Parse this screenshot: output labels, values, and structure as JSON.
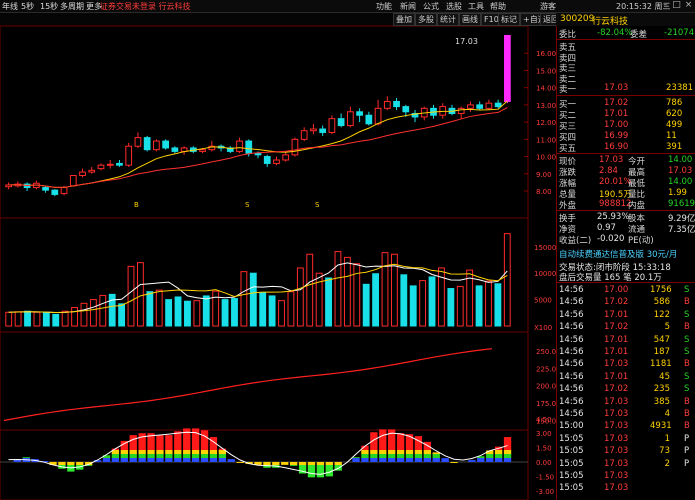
{
  "topbar": {
    "notice": "证券交易未登录  行云科技",
    "menus": [
      "功能",
      "新闻",
      "公式",
      "选股",
      "工具",
      "帮助"
    ],
    "app_name": "游客",
    "clock": "20:15:32 周三",
    "icon_minimize": "minimize-icon",
    "icon_maximize": "maximize-icon",
    "icon_close": "close-icon"
  },
  "periods": [
    "年线",
    "5秒",
    "15秒",
    "多周期",
    "更多"
  ],
  "tools": [
    "叠加",
    "多股",
    "统计",
    "画线",
    "F10",
    "标记",
    "+自选",
    "返回"
  ],
  "stock": {
    "code": "300209",
    "name": "行云科技"
  },
  "chart": {
    "high_label": "17.03",
    "price_axis": [
      "16.00",
      "15.00",
      "14.00",
      "13.00",
      "12.00",
      "11.00",
      "10.00",
      "9.00",
      "8.00"
    ],
    "vol_axis": [
      "15000",
      "10000",
      "5000",
      "X100"
    ],
    "ind_axis": [
      "250.0",
      "225.0",
      "200.0",
      "175.0",
      "150.0"
    ],
    "macd_axis": [
      "4.50",
      "3.00",
      "1.50",
      "0.00",
      "-1.50",
      "-3.00"
    ],
    "markers": [
      "B",
      "S",
      "S",
      "S"
    ],
    "colors": {
      "up": "#ff2a2a",
      "down": "#19e0e8",
      "limit": "#ff2aff",
      "ma": "#ffd200",
      "ma2": "#ff3030"
    },
    "candles": [
      {
        "o": 8.25,
        "c": 8.35,
        "h": 8.5,
        "l": 8.1
      },
      {
        "o": 8.3,
        "c": 8.4,
        "h": 8.55,
        "l": 8.2
      },
      {
        "o": 8.4,
        "c": 8.2,
        "h": 8.5,
        "l": 8.0
      },
      {
        "o": 8.2,
        "c": 8.45,
        "h": 8.6,
        "l": 8.1
      },
      {
        "o": 8.2,
        "c": 8.05,
        "h": 8.3,
        "l": 7.9
      },
      {
        "o": 8.05,
        "c": 7.8,
        "h": 8.1,
        "l": 7.7
      },
      {
        "o": 7.85,
        "c": 8.2,
        "h": 8.3,
        "l": 7.75
      },
      {
        "o": 8.3,
        "c": 8.9,
        "h": 8.9,
        "l": 8.25
      },
      {
        "o": 8.9,
        "c": 9.1,
        "h": 9.3,
        "l": 8.8
      },
      {
        "o": 9.1,
        "c": 9.2,
        "h": 9.4,
        "l": 9.0
      },
      {
        "o": 9.3,
        "c": 9.5,
        "h": 9.6,
        "l": 9.2
      },
      {
        "o": 9.5,
        "c": 9.55,
        "h": 9.8,
        "l": 9.3
      },
      {
        "o": 9.6,
        "c": 9.5,
        "h": 9.8,
        "l": 9.4
      },
      {
        "o": 9.5,
        "c": 10.6,
        "h": 10.8,
        "l": 9.4
      },
      {
        "o": 10.6,
        "c": 11.1,
        "h": 11.4,
        "l": 10.5
      },
      {
        "o": 11.1,
        "c": 10.4,
        "h": 11.2,
        "l": 10.3
      },
      {
        "o": 10.4,
        "c": 10.9,
        "h": 11.0,
        "l": 10.3
      },
      {
        "o": 10.9,
        "c": 10.5,
        "h": 11.0,
        "l": 10.4
      },
      {
        "o": 10.5,
        "c": 10.3,
        "h": 10.6,
        "l": 10.2
      },
      {
        "o": 10.3,
        "c": 10.5,
        "h": 10.6,
        "l": 10.1
      },
      {
        "o": 10.5,
        "c": 10.3,
        "h": 10.6,
        "l": 10.2
      },
      {
        "o": 10.3,
        "c": 10.4,
        "h": 10.5,
        "l": 10.2
      },
      {
        "o": 10.4,
        "c": 10.6,
        "h": 10.9,
        "l": 10.3
      },
      {
        "o": 10.6,
        "c": 10.5,
        "h": 10.7,
        "l": 10.3
      },
      {
        "o": 10.5,
        "c": 10.3,
        "h": 10.6,
        "l": 10.2
      },
      {
        "o": 10.3,
        "c": 10.9,
        "h": 11.1,
        "l": 10.2
      },
      {
        "o": 10.9,
        "c": 10.2,
        "h": 11.0,
        "l": 10.0
      },
      {
        "o": 10.2,
        "c": 10.1,
        "h": 10.3,
        "l": 9.9
      },
      {
        "o": 10.0,
        "c": 9.6,
        "h": 10.1,
        "l": 9.4
      },
      {
        "o": 9.6,
        "c": 9.8,
        "h": 10.0,
        "l": 9.5
      },
      {
        "o": 9.8,
        "c": 10.1,
        "h": 10.3,
        "l": 9.7
      },
      {
        "o": 10.1,
        "c": 11.0,
        "h": 11.1,
        "l": 10.0
      },
      {
        "o": 11.0,
        "c": 11.5,
        "h": 11.7,
        "l": 10.9
      },
      {
        "o": 11.5,
        "c": 11.6,
        "h": 11.9,
        "l": 11.3
      },
      {
        "o": 11.6,
        "c": 11.4,
        "h": 11.8,
        "l": 11.2
      },
      {
        "o": 11.4,
        "c": 12.2,
        "h": 12.4,
        "l": 11.3
      },
      {
        "o": 12.2,
        "c": 11.8,
        "h": 12.5,
        "l": 11.7
      },
      {
        "o": 11.8,
        "c": 12.6,
        "h": 12.9,
        "l": 11.7
      },
      {
        "o": 12.6,
        "c": 12.4,
        "h": 12.8,
        "l": 12.0
      },
      {
        "o": 12.4,
        "c": 11.9,
        "h": 12.6,
        "l": 11.8
      },
      {
        "o": 11.9,
        "c": 12.8,
        "h": 13.3,
        "l": 11.8
      },
      {
        "o": 12.8,
        "c": 13.2,
        "h": 13.5,
        "l": 12.7
      },
      {
        "o": 13.2,
        "c": 12.9,
        "h": 13.4,
        "l": 12.7
      },
      {
        "o": 12.9,
        "c": 12.6,
        "h": 13.0,
        "l": 12.3
      },
      {
        "o": 12.5,
        "c": 12.3,
        "h": 12.7,
        "l": 12.0
      },
      {
        "o": 12.3,
        "c": 12.8,
        "h": 12.9,
        "l": 12.1
      },
      {
        "o": 12.8,
        "c": 12.4,
        "h": 13.0,
        "l": 12.2
      },
      {
        "o": 12.4,
        "c": 12.9,
        "h": 13.1,
        "l": 12.2
      },
      {
        "o": 12.8,
        "c": 12.5,
        "h": 13.0,
        "l": 12.4
      },
      {
        "o": 12.5,
        "c": 12.8,
        "h": 12.9,
        "l": 12.2
      },
      {
        "o": 12.8,
        "c": 13.0,
        "h": 13.2,
        "l": 12.6
      },
      {
        "o": 13.0,
        "c": 12.8,
        "h": 13.2,
        "l": 12.7
      },
      {
        "o": 12.8,
        "c": 13.1,
        "h": 13.3,
        "l": 12.7
      },
      {
        "o": 13.1,
        "c": 12.9,
        "h": 13.3,
        "l": 12.8
      },
      {
        "o": 13.2,
        "c": 17.03,
        "h": 17.03,
        "l": 13.1,
        "limit": true
      }
    ],
    "volumes": [
      {
        "v": 2600,
        "up": true
      },
      {
        "v": 2700,
        "up": true
      },
      {
        "v": 2800,
        "up": false
      },
      {
        "v": 2600,
        "up": true
      },
      {
        "v": 2500,
        "up": false
      },
      {
        "v": 2200,
        "up": false
      },
      {
        "v": 2800,
        "up": true
      },
      {
        "v": 3500,
        "up": true
      },
      {
        "v": 4300,
        "up": true
      },
      {
        "v": 5000,
        "up": true
      },
      {
        "v": 5800,
        "up": true
      },
      {
        "v": 6000,
        "up": false
      },
      {
        "v": 4200,
        "up": false
      },
      {
        "v": 11300,
        "up": true
      },
      {
        "v": 12000,
        "up": true
      },
      {
        "v": 6500,
        "up": false
      },
      {
        "v": 6800,
        "up": true
      },
      {
        "v": 5000,
        "up": false
      },
      {
        "v": 5500,
        "up": false
      },
      {
        "v": 4700,
        "up": false
      },
      {
        "v": 4800,
        "up": true
      },
      {
        "v": 5700,
        "up": false
      },
      {
        "v": 6600,
        "up": true
      },
      {
        "v": 5000,
        "up": false
      },
      {
        "v": 5200,
        "up": false
      },
      {
        "v": 10300,
        "up": true
      },
      {
        "v": 10000,
        "up": false
      },
      {
        "v": 6300,
        "up": false
      },
      {
        "v": 5700,
        "up": false
      },
      {
        "v": 4800,
        "up": true
      },
      {
        "v": 6500,
        "up": true
      },
      {
        "v": 11000,
        "up": true
      },
      {
        "v": 13600,
        "up": true
      },
      {
        "v": 10000,
        "up": true
      },
      {
        "v": 9100,
        "up": false
      },
      {
        "v": 14100,
        "up": true
      },
      {
        "v": 13000,
        "up": true
      },
      {
        "v": 11800,
        "up": true
      },
      {
        "v": 7900,
        "up": false
      },
      {
        "v": 9900,
        "up": false
      },
      {
        "v": 13900,
        "up": true
      },
      {
        "v": 13600,
        "up": true
      },
      {
        "v": 9700,
        "up": false
      },
      {
        "v": 7600,
        "up": false
      },
      {
        "v": 8600,
        "up": true
      },
      {
        "v": 9300,
        "up": false
      },
      {
        "v": 11000,
        "up": true
      },
      {
        "v": 7100,
        "up": false
      },
      {
        "v": 7500,
        "up": true
      },
      {
        "v": 10600,
        "up": true
      },
      {
        "v": 7600,
        "up": false
      },
      {
        "v": 8500,
        "up": true
      },
      {
        "v": 8000,
        "up": false
      },
      {
        "v": 17500,
        "up": true
      }
    ],
    "macd": [
      0,
      0.3,
      0.5,
      0.3,
      0.1,
      -0.3,
      -0.7,
      -1.0,
      -0.8,
      -0.4,
      0.2,
      0.7,
      1.4,
      2.2,
      2.8,
      3.0,
      3.0,
      2.8,
      2.8,
      3.2,
      3.5,
      3.5,
      3.3,
      2.6,
      1.4,
      0.3,
      -0.1,
      -0.2,
      -0.3,
      -0.6,
      -0.6,
      -0.3,
      -0.4,
      -1.2,
      -1.6,
      -1.6,
      -1.5,
      -0.9,
      0.0,
      0.5,
      1.7,
      3.1,
      3.4,
      3.4,
      3.0,
      2.9,
      2.7,
      2.1,
      1.0,
      0.4,
      -0.1,
      0.0,
      0.2,
      0.6,
      1.2,
      1.6,
      2.6
    ]
  },
  "quote": {
    "weibi_label": "委比",
    "weibi": "-82.04%",
    "weicha_label": "委差",
    "weicha": "-21074",
    "asks": [
      {
        "label": "卖五",
        "price": "",
        "vol": ""
      },
      {
        "label": "卖四",
        "price": "",
        "vol": ""
      },
      {
        "label": "卖三",
        "price": "",
        "vol": ""
      },
      {
        "label": "卖二",
        "price": "",
        "vol": ""
      },
      {
        "label": "卖一",
        "price": "17.03",
        "vol": "23381"
      }
    ],
    "bids": [
      {
        "label": "买一",
        "price": "17.02",
        "vol": "786"
      },
      {
        "label": "买二",
        "price": "17.01",
        "vol": "620"
      },
      {
        "label": "买三",
        "price": "17.00",
        "vol": "499"
      },
      {
        "label": "买四",
        "price": "16.99",
        "vol": "11"
      },
      {
        "label": "买五",
        "price": "16.90",
        "vol": "391"
      }
    ],
    "stats": [
      {
        "l1": "现价",
        "v1": "17.03",
        "c1": "red",
        "l2": "今开",
        "v2": "14.00",
        "c2": "grn"
      },
      {
        "l1": "涨跌",
        "v1": "2.84",
        "c1": "red",
        "l2": "最高",
        "v2": "17.03",
        "c2": "red"
      },
      {
        "l1": "涨幅",
        "v1": "20.01%",
        "c1": "red",
        "l2": "最低",
        "v2": "14.00",
        "c2": "grn"
      },
      {
        "l1": "总量",
        "v1": "190.5万",
        "c1": "yel",
        "l2": "量比",
        "v2": "1.99",
        "c2": "yel"
      },
      {
        "l1": "外盘",
        "v1": "988812",
        "c1": "red",
        "l2": "内盘",
        "v2": "916198",
        "c2": "grn"
      }
    ],
    "stats2": [
      {
        "l1": "换手",
        "v1": "25.93%",
        "l2": "股本",
        "v2": "9.29亿"
      },
      {
        "l1": "净资",
        "v1": "0.97",
        "l2": "流通",
        "v2": "7.35亿"
      },
      {
        "l1": "收益(二)",
        "v1": "-0.020",
        "l2": "PE(动)",
        "v2": ""
      }
    ],
    "banner": "自动续费通达信普及版  30元/月",
    "status": "交易状态:闭市阶段 15:33:18",
    "auction": "盘后交易量 165 笔 20.1万"
  },
  "ticks": [
    {
      "t": "14:56",
      "p": "17.00",
      "v": "1756",
      "s": "S"
    },
    {
      "t": "14:56",
      "p": "17.02",
      "v": "586",
      "s": "B"
    },
    {
      "t": "14:56",
      "p": "17.01",
      "v": "122",
      "s": "S"
    },
    {
      "t": "14:56",
      "p": "17.02",
      "v": "5",
      "s": "B"
    },
    {
      "t": "14:56",
      "p": "17.01",
      "v": "547",
      "s": "S"
    },
    {
      "t": "14:56",
      "p": "17.01",
      "v": "187",
      "s": "S"
    },
    {
      "t": "14:56",
      "p": "17.03",
      "v": "1181",
      "s": "B"
    },
    {
      "t": "14:56",
      "p": "17.01",
      "v": "45",
      "s": "S"
    },
    {
      "t": "14:56",
      "p": "17.02",
      "v": "235",
      "s": "S"
    },
    {
      "t": "14:56",
      "p": "17.03",
      "v": "385",
      "s": "B"
    },
    {
      "t": "14:56",
      "p": "17.03",
      "v": "4",
      "s": "B"
    },
    {
      "t": "15:00",
      "p": "17.03",
      "v": "4931",
      "s": "B"
    },
    {
      "t": "15:05",
      "p": "17.03",
      "v": "1",
      "s": "P"
    },
    {
      "t": "15:05",
      "p": "17.03",
      "v": "73",
      "s": "P"
    },
    {
      "t": "15:05",
      "p": "17.03",
      "v": "2",
      "s": "P"
    },
    {
      "t": "15:05",
      "p": "17.03",
      "v": "",
      "s": ""
    },
    {
      "t": "15:05",
      "p": "17.03",
      "v": "",
      "s": ""
    }
  ]
}
